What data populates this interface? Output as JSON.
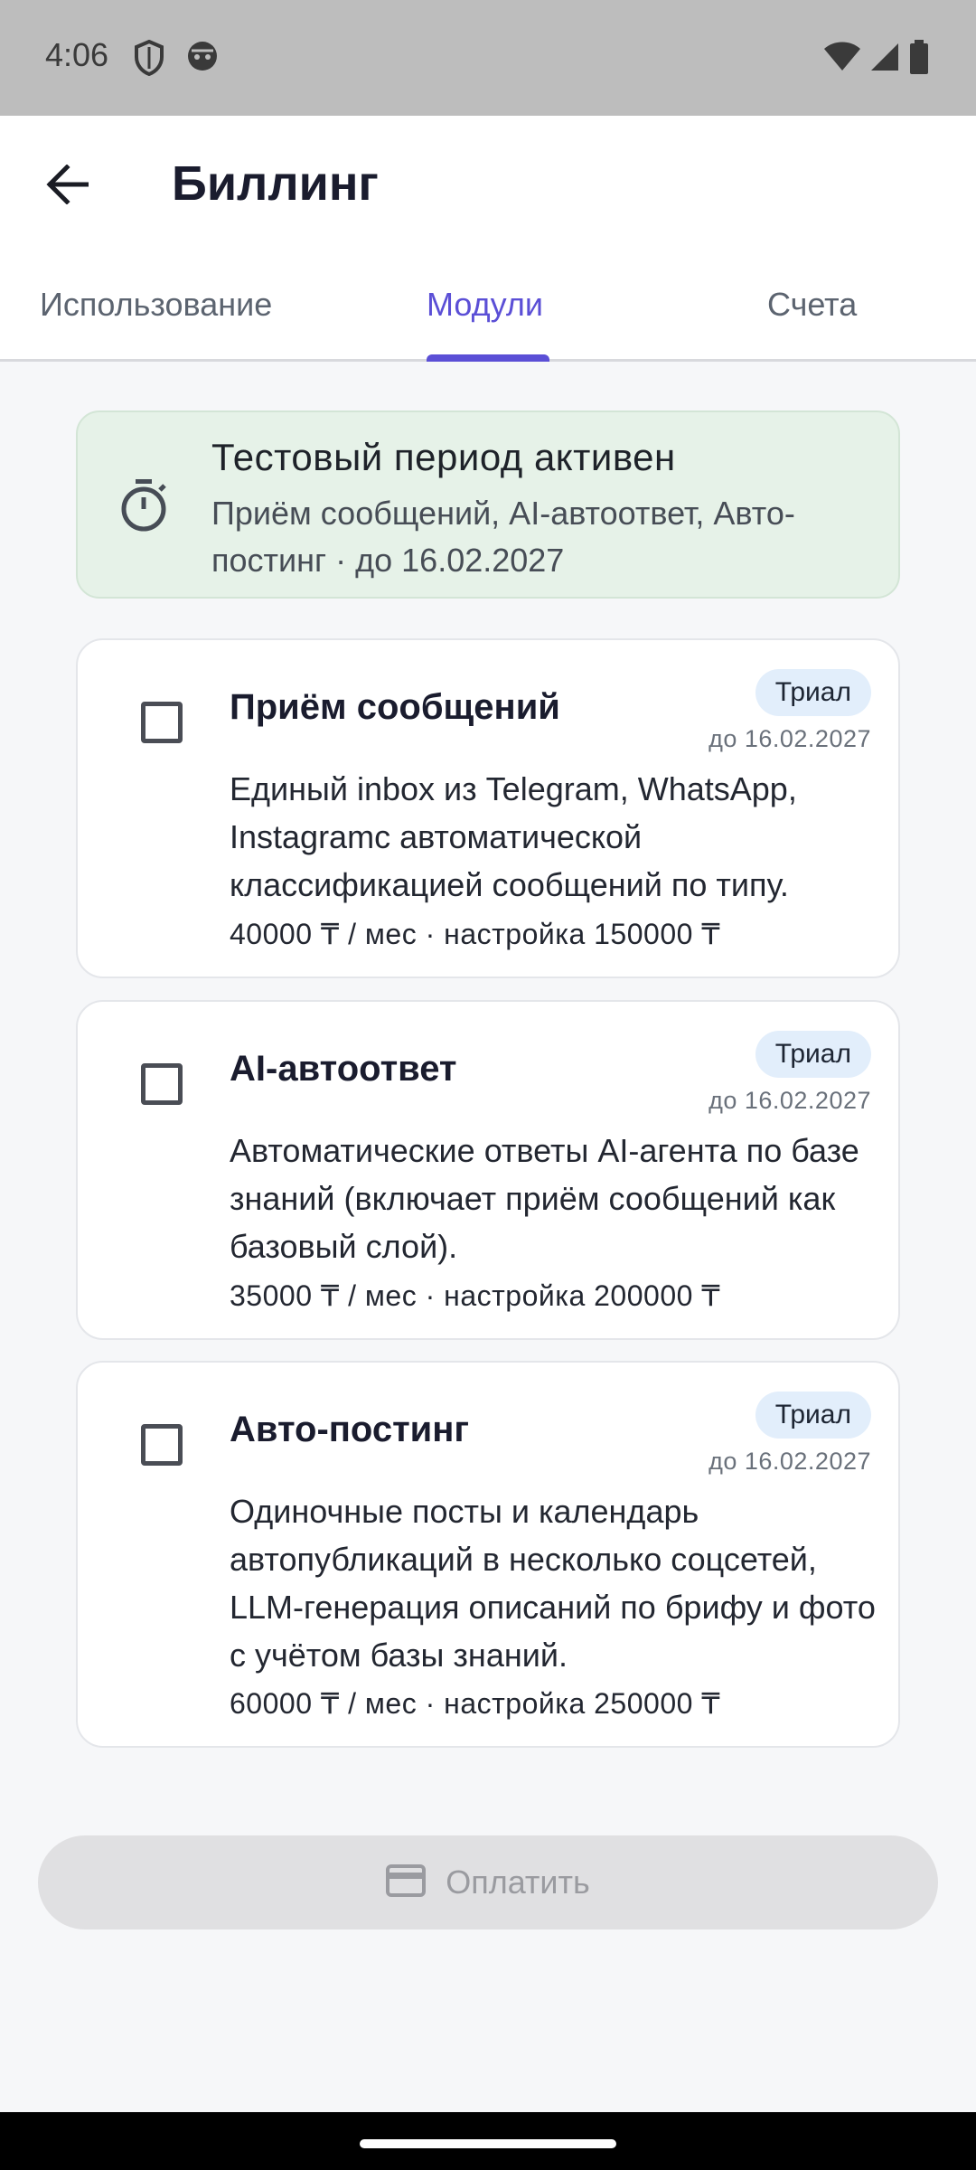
{
  "status_bar": {
    "time": "4:06"
  },
  "app_bar": {
    "title": "Биллинг"
  },
  "tabs": [
    {
      "label": "Использование"
    },
    {
      "label": "Модули",
      "active": true
    },
    {
      "label": "Счета"
    }
  ],
  "trial_banner": {
    "title": "Тестовый период активен",
    "text": "Приём сообщений, AI-автоответ, Авто-постинг · до 16.02.2027"
  },
  "modules": [
    {
      "title": "Приём сообщений",
      "badge": "Триал",
      "until": "до 16.02.2027",
      "description": "Единый inbox из Telegram, WhatsApp, Instagramс автоматической классификацией сообщений по типу.",
      "price": "40000 ₸ / мес · настройка 150000 ₸",
      "checked": false
    },
    {
      "title": "AI-автоответ",
      "badge": "Триал",
      "until": "до 16.02.2027",
      "description": "Автоматические ответы AI-агента по базе знаний (включает приём сообщений как базовый слой).",
      "price": "35000 ₸ / мес · настройка 200000 ₸",
      "checked": false
    },
    {
      "title": "Авто-постинг",
      "badge": "Триал",
      "until": "до 16.02.2027",
      "description": "Одиночные посты и календарь автопубликаций в несколько соцсетей, LLM-генерация описаний по брифу и фото с учётом базы знаний.",
      "price": "60000 ₸ / мес · настройка 250000 ₸",
      "checked": false
    }
  ],
  "pay_button": {
    "label": "Оплатить",
    "icon": "credit-card-icon",
    "enabled": false
  },
  "colors": {
    "accent": "#5B4FD6",
    "banner_bg": "#E6F2E8",
    "badge_bg": "#E2EEFB",
    "button_disabled_bg": "#E0E0E2"
  }
}
